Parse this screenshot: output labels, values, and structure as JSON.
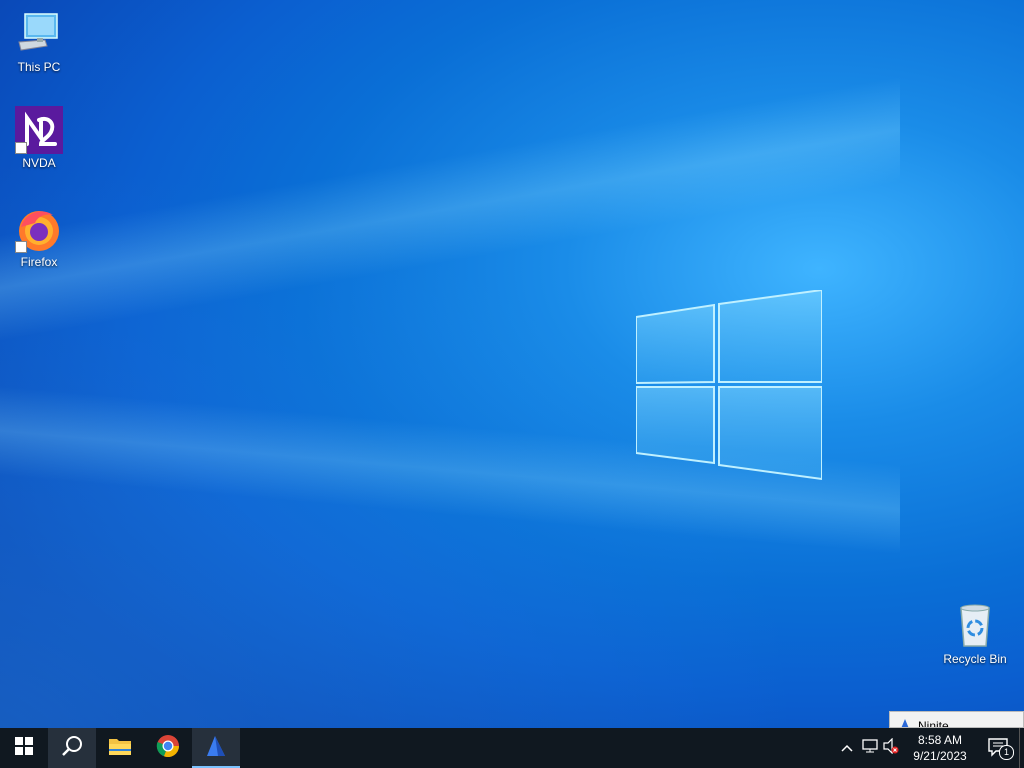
{
  "desktop": {
    "icons": [
      {
        "label": "This PC",
        "icon": "monitor-icon"
      },
      {
        "label": "NVDA",
        "icon": "nvda-icon"
      },
      {
        "label": "Firefox",
        "icon": "firefox-icon"
      },
      {
        "label": "Recycle Bin",
        "icon": "recycle-bin-icon"
      }
    ]
  },
  "taskbar": {
    "buttons": [
      {
        "name": "start",
        "icon": "windows-logo-icon"
      },
      {
        "name": "search",
        "icon": "search-icon"
      },
      {
        "name": "file-explorer",
        "icon": "folder-icon"
      },
      {
        "name": "chrome",
        "icon": "chrome-icon"
      },
      {
        "name": "ninite",
        "icon": "ninite-icon"
      }
    ],
    "tray": {
      "time": "8:58 AM",
      "date": "9/21/2023",
      "notification_count": "1"
    },
    "popup_label": "Ninite"
  },
  "colors": {
    "taskbar": "#101820",
    "accent": "#7cc3ff"
  }
}
